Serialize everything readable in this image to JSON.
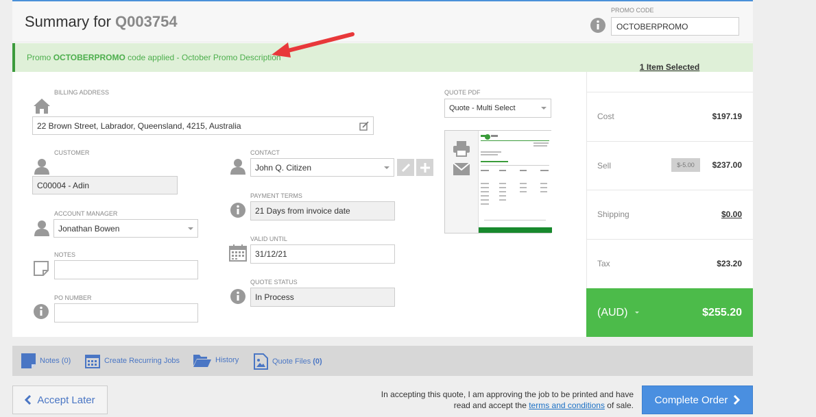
{
  "header": {
    "title_prefix": "Summary for",
    "quote_id": "Q003754"
  },
  "promo": {
    "label": "PROMO CODE",
    "value": "OCTOBERPROMO",
    "banner_prefix": "Promo",
    "banner_code": "OCTOBERPROMO",
    "banner_suffix": "code applied - October Promo Description"
  },
  "billing": {
    "label": "BILLING ADDRESS",
    "value": "22 Brown Street, Labrador, Queensland, 4215, Australia"
  },
  "customer": {
    "label": "CUSTOMER",
    "value": "C00004 - Adin"
  },
  "account_manager": {
    "label": "ACCOUNT MANAGER",
    "value": "Jonathan Bowen"
  },
  "notes": {
    "label": "NOTES",
    "value": ""
  },
  "po_number": {
    "label": "PO NUMBER",
    "value": ""
  },
  "contact": {
    "label": "CONTACT",
    "value": "John Q. Citizen"
  },
  "payment_terms": {
    "label": "PAYMENT TERMS",
    "value": "21 Days from invoice date"
  },
  "valid_until": {
    "label": "VALID UNTIL",
    "value": "31/12/21"
  },
  "quote_status": {
    "label": "QUOTE STATUS",
    "value": "In Process"
  },
  "quote_pdf": {
    "label": "QUOTE PDF",
    "value": "Quote - Multi Select"
  },
  "summary": {
    "items_selected": "1 Item Selected",
    "cost_label": "Cost",
    "cost_value": "$197.19",
    "sell_label": "Sell",
    "sell_discount": "$-5.00",
    "sell_value": "$237.00",
    "shipping_label": "Shipping",
    "shipping_value": "$0.00",
    "tax_label": "Tax",
    "tax_value": "$23.20",
    "currency": "(AUD)",
    "total": "$255.20"
  },
  "toolbar": {
    "notes": "Notes (0)",
    "recurring": "Create Recurring Jobs",
    "history": "History",
    "quote_files": "Quote Files",
    "quote_files_count": "(0)"
  },
  "footer": {
    "accept_later": "Accept Later",
    "terms_line1": "In accepting this quote, I am approving the job to be printed and have",
    "terms_line2_prefix": "read and accept the",
    "terms_link": "terms and conditions",
    "terms_line2_suffix": "of sale.",
    "complete_order": "Complete Order"
  },
  "colors": {
    "accent": "#4a8fe0",
    "success": "#4cbb4a",
    "promo_banner": "#dff0d8",
    "link": "#4a76c4"
  }
}
